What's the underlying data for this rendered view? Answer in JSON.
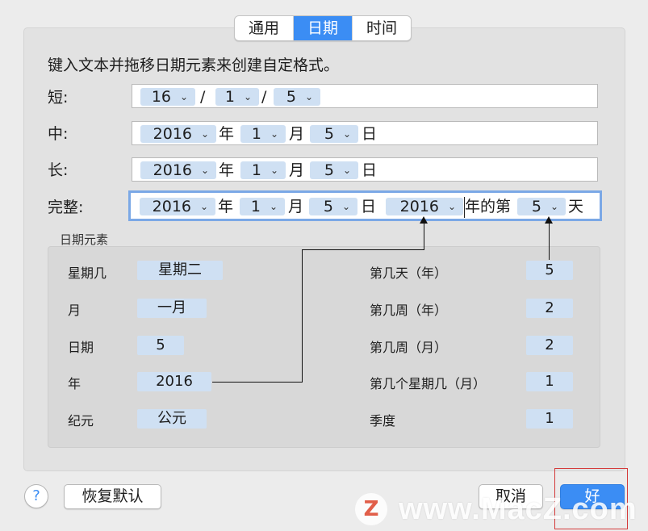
{
  "tabs": [
    {
      "label": "通用",
      "active": false
    },
    {
      "label": "日期",
      "active": true
    },
    {
      "label": "时间",
      "active": false
    }
  ],
  "instruction": "键入文本并拖移日期元素来创建自定格式。",
  "formats": {
    "short": {
      "label": "短:",
      "year": "16",
      "sep1": "/",
      "month": "1",
      "sep2": "/",
      "day": "5"
    },
    "medium": {
      "label": "中:",
      "year": "2016",
      "year_suffix": "年",
      "month": "1",
      "month_suffix": "月",
      "day": "5",
      "day_suffix": "日"
    },
    "long": {
      "label": "长:",
      "year": "2016",
      "year_suffix": "年",
      "month": "1",
      "month_suffix": "月",
      "day": "5",
      "day_suffix": "日"
    },
    "full": {
      "label": "完整:",
      "year": "2016",
      "year_suffix": "年",
      "month": "1",
      "month_suffix": "月",
      "day": "5",
      "day_suffix": "日",
      "year2": "2016",
      "text_mid": "年的第",
      "day_of_year": "5",
      "text_end": "天"
    }
  },
  "date_elements": {
    "title": "日期元素",
    "left": [
      {
        "name": "星期几",
        "value": "星期二"
      },
      {
        "name": "月",
        "value": "一月"
      },
      {
        "name": "日期",
        "value": "5"
      },
      {
        "name": "年",
        "value": "2016"
      },
      {
        "name": "纪元",
        "value": "公元"
      }
    ],
    "right": [
      {
        "name": "第几天（年）",
        "value": "5"
      },
      {
        "name": "第几周（年）",
        "value": "2"
      },
      {
        "name": "第几周（月）",
        "value": "2"
      },
      {
        "name": "第几个星期几（月）",
        "value": "1"
      },
      {
        "name": "季度",
        "value": "1"
      }
    ]
  },
  "buttons": {
    "help": "?",
    "restore_defaults": "恢复默认",
    "cancel": "取消",
    "ok": "好"
  },
  "watermark": {
    "logo": "Z",
    "text": "www.MacZ.com"
  },
  "colors": {
    "accent": "#3b8df4",
    "token": "#cfe0f3",
    "highlight_box": "#d43a3a"
  }
}
